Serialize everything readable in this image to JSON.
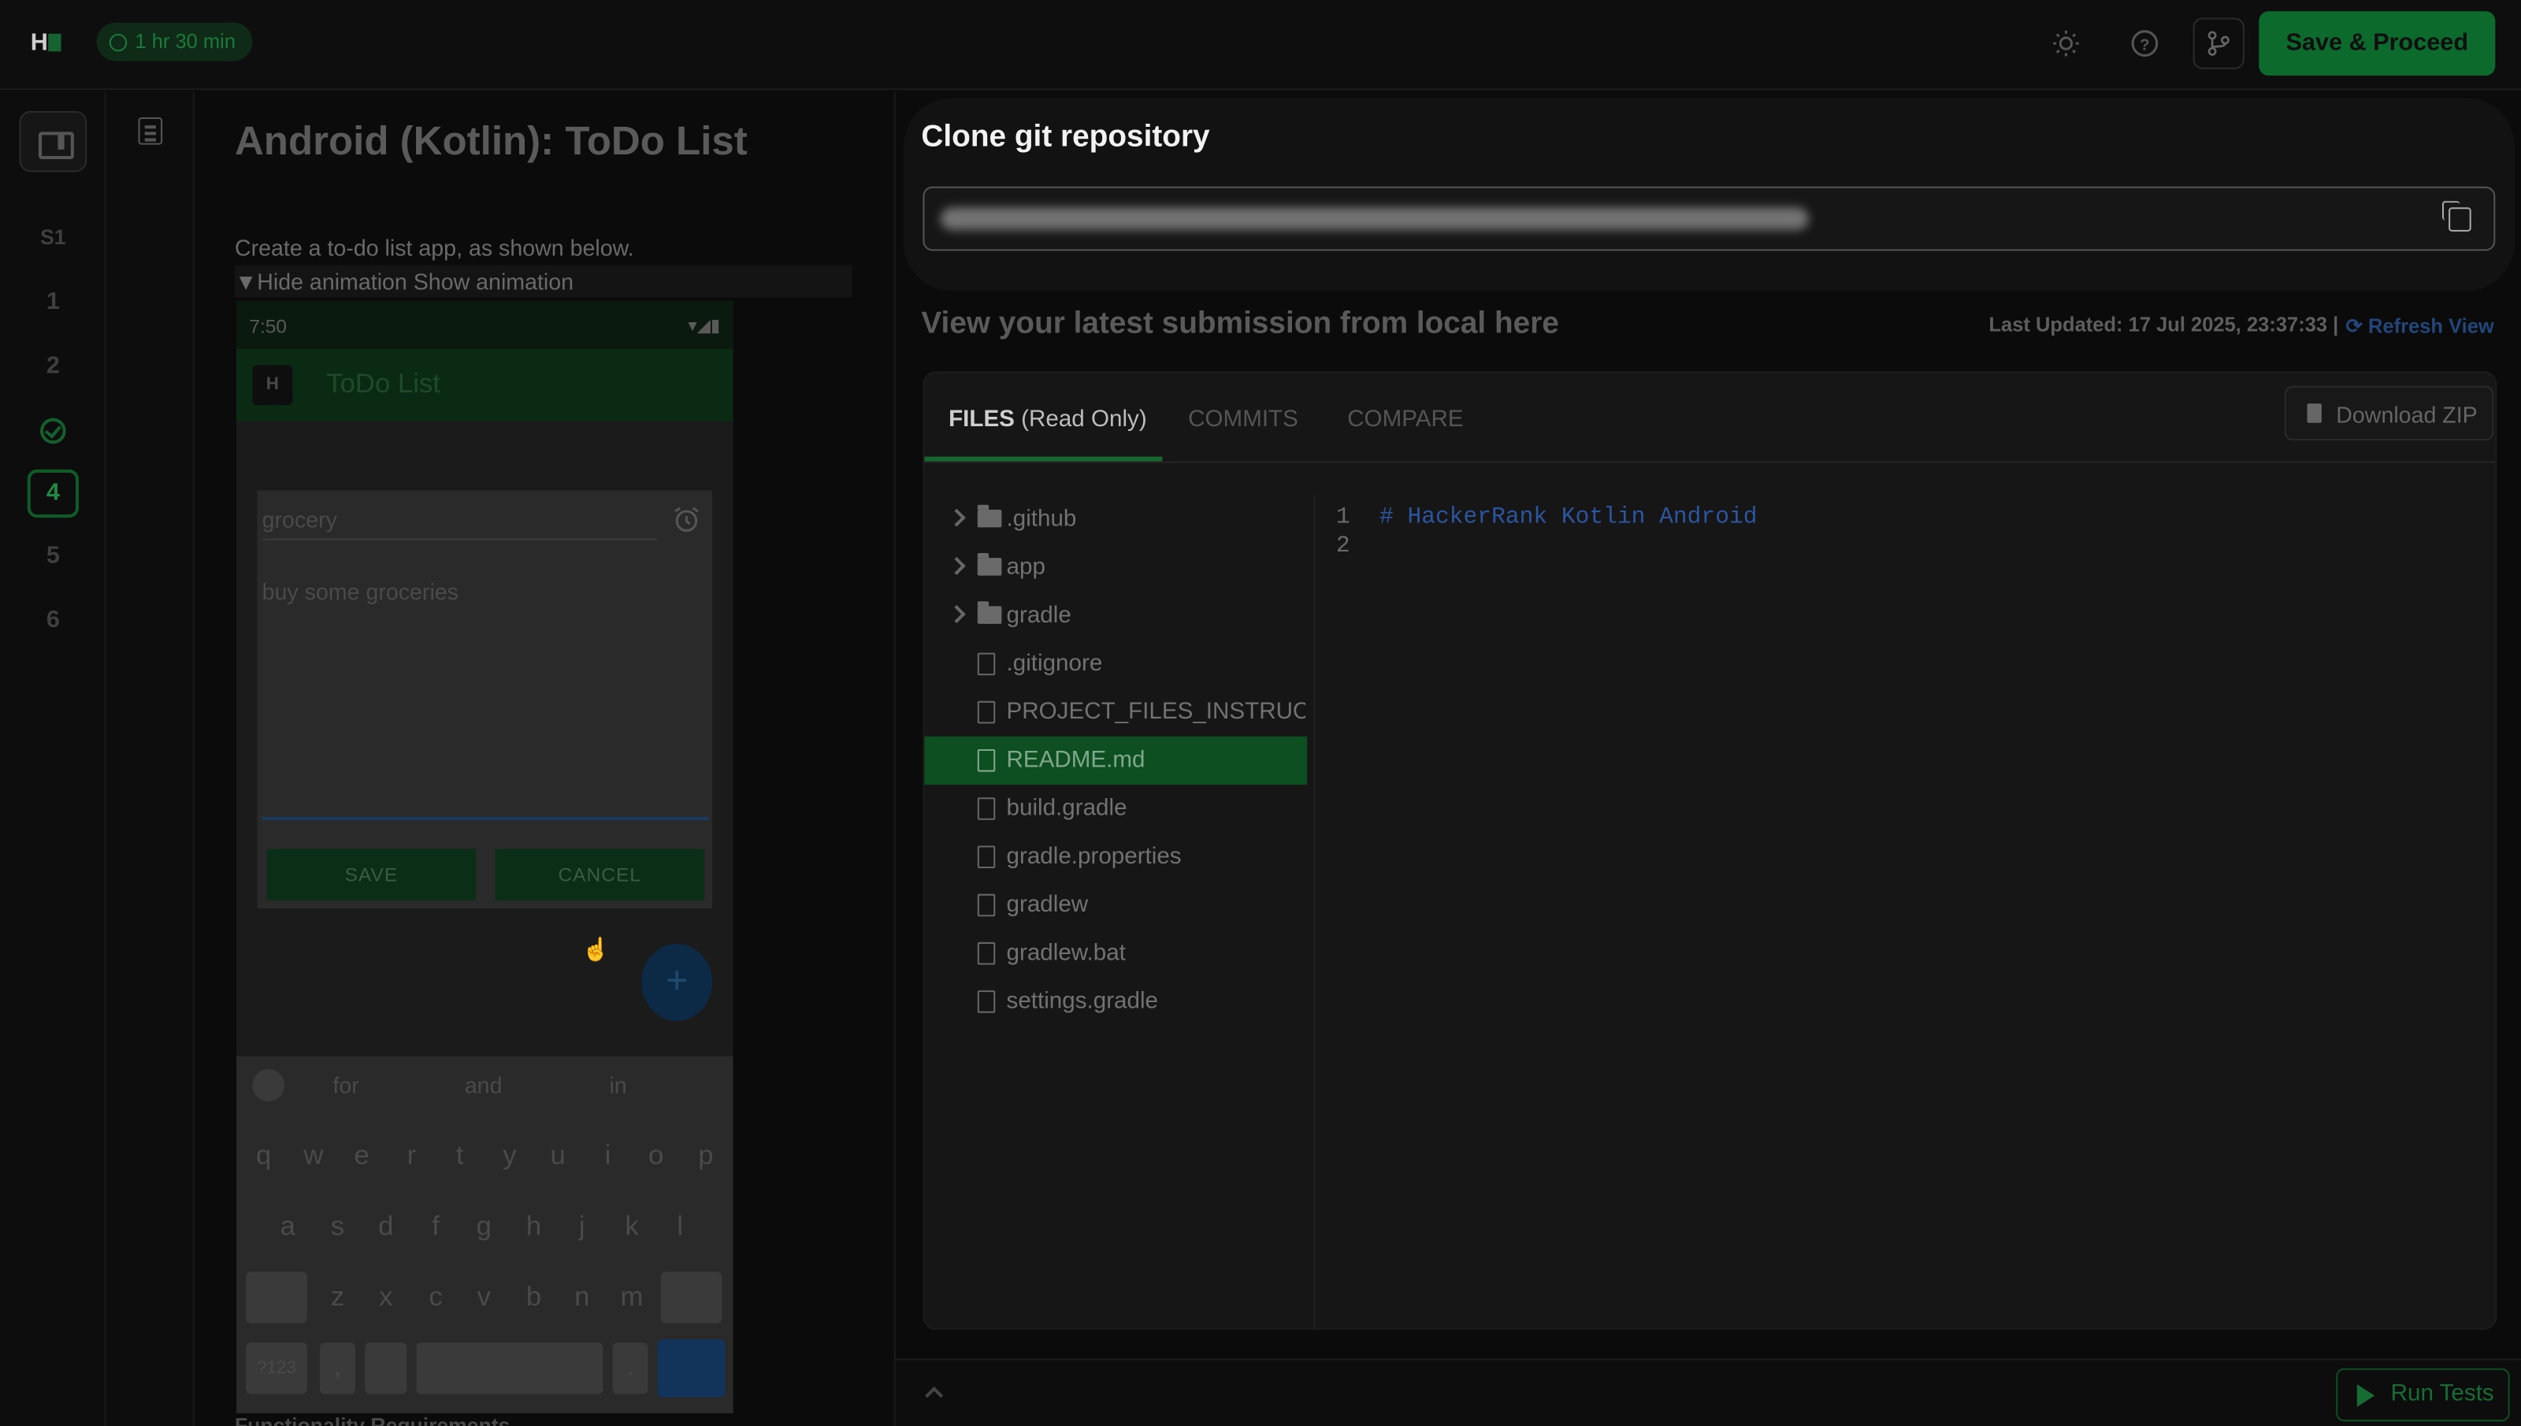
{
  "header": {
    "logo_text": "H",
    "timer": "1 hr 30 min",
    "save_label": "Save & Proceed",
    "icons": [
      "sun-icon",
      "help-icon",
      "git-branch-icon"
    ]
  },
  "rail": {
    "items": [
      "S1",
      "1",
      "2",
      "3",
      "4",
      "5",
      "6"
    ],
    "current": "4",
    "completed": "3"
  },
  "question": {
    "title": "Android (Kotlin): ToDo List",
    "description": "Create a to-do list app, as shown below.",
    "anim_toggle": "▼Hide animation Show animation",
    "next_heading": "Functionality Requirements"
  },
  "phone": {
    "time": "7:50",
    "app_title": "ToDo List",
    "logo": "H",
    "title_input": "grocery",
    "body_text": "buy some groceries",
    "save": "SAVE",
    "cancel": "CANCEL",
    "fab": "+",
    "suggestions": [
      "for",
      "and",
      "in"
    ],
    "row1": [
      "q",
      "w",
      "e",
      "r",
      "t",
      "y",
      "u",
      "i",
      "o",
      "p"
    ],
    "row2": [
      "a",
      "s",
      "d",
      "f",
      "g",
      "h",
      "j",
      "k",
      "l"
    ],
    "row3": [
      "z",
      "x",
      "c",
      "v",
      "b",
      "n",
      "m"
    ],
    "sym": "?123",
    "comma": ",",
    "period": "."
  },
  "clone": {
    "title": "Clone git repository"
  },
  "submission": {
    "heading": "View your latest submission from local here",
    "last_updated": "Last Updated: 17 Jul 2025, 23:37:33 |",
    "refresh": "Refresh View",
    "tabs": [
      {
        "label_main": "FILES",
        "label_sub": " (Read Only)"
      },
      {
        "label_main": "COMMITS"
      },
      {
        "label_main": "COMPARE"
      }
    ],
    "download": "Download ZIP",
    "tree": [
      {
        "name": ".github",
        "type": "folder"
      },
      {
        "name": "app",
        "type": "folder"
      },
      {
        "name": "gradle",
        "type": "folder"
      },
      {
        "name": ".gitignore",
        "type": "file"
      },
      {
        "name": "PROJECT_FILES_INSTRUCTIONS.md",
        "type": "file"
      },
      {
        "name": "README.md",
        "type": "file",
        "selected": true
      },
      {
        "name": "build.gradle",
        "type": "file"
      },
      {
        "name": "gradle.properties",
        "type": "file"
      },
      {
        "name": "gradlew",
        "type": "file"
      },
      {
        "name": "gradlew.bat",
        "type": "file"
      },
      {
        "name": "settings.gradle",
        "type": "file"
      }
    ],
    "code_lines": [
      "# HackerRank Kotlin Android",
      ""
    ]
  },
  "footer": {
    "run_tests": "Run Tests"
  },
  "colors": {
    "accent_green": "#1ba94c",
    "selected_row": "#0e4f21",
    "link_blue": "#22467a"
  }
}
